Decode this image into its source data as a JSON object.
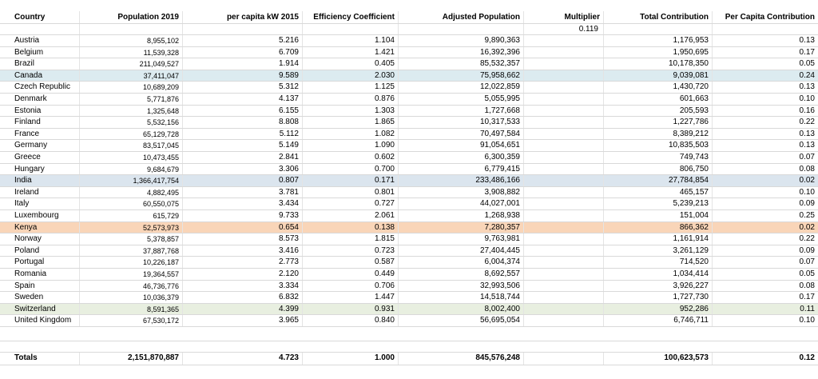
{
  "headers": {
    "country": "Country",
    "population": "Population 2019",
    "per_capita_kw": "per capita  kW 2015",
    "efficiency": "Efficiency Coefficient",
    "adjusted_population": "Adjusted Population",
    "multiplier": "Multiplier",
    "total_contribution": "Total Contribution",
    "per_capita_contribution": "Per Capita Contribution"
  },
  "multiplier_value": "0.119",
  "rows": [
    {
      "country": "Austria",
      "population": "8,955,102",
      "kw": "5.216",
      "eff": "1.104",
      "adj": "9,890,363",
      "total": "1,176,953",
      "pcc": "0.13"
    },
    {
      "country": "Belgium",
      "population": "11,539,328",
      "kw": "6.709",
      "eff": "1.421",
      "adj": "16,392,396",
      "total": "1,950,695",
      "pcc": "0.17"
    },
    {
      "country": "Brazil",
      "population": "211,049,527",
      "kw": "1.914",
      "eff": "0.405",
      "adj": "85,532,357",
      "total": "10,178,350",
      "pcc": "0.05"
    },
    {
      "country": "Canada",
      "population": "37,411,047",
      "kw": "9.589",
      "eff": "2.030",
      "adj": "75,958,662",
      "total": "9,039,081",
      "pcc": "0.24"
    },
    {
      "country": "Czech Republic",
      "population": "10,689,209",
      "kw": "5.312",
      "eff": "1.125",
      "adj": "12,022,859",
      "total": "1,430,720",
      "pcc": "0.13"
    },
    {
      "country": "Denmark",
      "population": "5,771,876",
      "kw": "4.137",
      "eff": "0.876",
      "adj": "5,055,995",
      "total": "601,663",
      "pcc": "0.10"
    },
    {
      "country": "Estonia",
      "population": "1,325,648",
      "kw": "6.155",
      "eff": "1.303",
      "adj": "1,727,668",
      "total": "205,593",
      "pcc": "0.16"
    },
    {
      "country": "Finland",
      "population": "5,532,156",
      "kw": "8.808",
      "eff": "1.865",
      "adj": "10,317,533",
      "total": "1,227,786",
      "pcc": "0.22"
    },
    {
      "country": "France",
      "population": "65,129,728",
      "kw": "5.112",
      "eff": "1.082",
      "adj": "70,497,584",
      "total": "8,389,212",
      "pcc": "0.13"
    },
    {
      "country": "Germany",
      "population": "83,517,045",
      "kw": "5.149",
      "eff": "1.090",
      "adj": "91,054,651",
      "total": "10,835,503",
      "pcc": "0.13"
    },
    {
      "country": "Greece",
      "population": "10,473,455",
      "kw": "2.841",
      "eff": "0.602",
      "adj": "6,300,359",
      "total": "749,743",
      "pcc": "0.07"
    },
    {
      "country": "Hungary",
      "population": "9,684,679",
      "kw": "3.306",
      "eff": "0.700",
      "adj": "6,779,415",
      "total": "806,750",
      "pcc": "0.08"
    },
    {
      "country": "India",
      "population": "1,366,417,754",
      "kw": "0.807",
      "eff": "0.171",
      "adj": "233,486,166",
      "total": "27,784,854",
      "pcc": "0.02"
    },
    {
      "country": "Ireland",
      "population": "4,882,495",
      "kw": "3.781",
      "eff": "0.801",
      "adj": "3,908,882",
      "total": "465,157",
      "pcc": "0.10"
    },
    {
      "country": "Italy",
      "population": "60,550,075",
      "kw": "3.434",
      "eff": "0.727",
      "adj": "44,027,001",
      "total": "5,239,213",
      "pcc": "0.09"
    },
    {
      "country": "Luxembourg",
      "population": "615,729",
      "kw": "9.733",
      "eff": "2.061",
      "adj": "1,268,938",
      "total": "151,004",
      "pcc": "0.25"
    },
    {
      "country": "Kenya",
      "population": "52,573,973",
      "kw": "0.654",
      "eff": "0.138",
      "adj": "7,280,357",
      "total": "866,362",
      "pcc": "0.02"
    },
    {
      "country": "Norway",
      "population": "5,378,857",
      "kw": "8.573",
      "eff": "1.815",
      "adj": "9,763,981",
      "total": "1,161,914",
      "pcc": "0.22"
    },
    {
      "country": "Poland",
      "population": "37,887,768",
      "kw": "3.416",
      "eff": "0.723",
      "adj": "27,404,445",
      "total": "3,261,129",
      "pcc": "0.09"
    },
    {
      "country": "Portugal",
      "population": "10,226,187",
      "kw": "2.773",
      "eff": "0.587",
      "adj": "6,004,374",
      "total": "714,520",
      "pcc": "0.07"
    },
    {
      "country": "Romania",
      "population": "19,364,557",
      "kw": "2.120",
      "eff": "0.449",
      "adj": "8,692,557",
      "total": "1,034,414",
      "pcc": "0.05"
    },
    {
      "country": "Spain",
      "population": "46,736,776",
      "kw": "3.334",
      "eff": "0.706",
      "adj": "32,993,506",
      "total": "3,926,227",
      "pcc": "0.08"
    },
    {
      "country": "Sweden",
      "population": "10,036,379",
      "kw": "6.832",
      "eff": "1.447",
      "adj": "14,518,744",
      "total": "1,727,730",
      "pcc": "0.17"
    },
    {
      "country": "Switzerland",
      "population": "8,591,365",
      "kw": "4.399",
      "eff": "0.931",
      "adj": "8,002,400",
      "total": "952,286",
      "pcc": "0.11"
    },
    {
      "country": "United Kingdom",
      "population": "67,530,172",
      "kw": "3.965",
      "eff": "0.840",
      "adj": "56,695,054",
      "total": "6,746,711",
      "pcc": "0.10"
    }
  ],
  "totals": {
    "label": "Totals",
    "population": "2,151,870,887",
    "kw": "4.723",
    "eff": "1.000",
    "adj": "845,576,248",
    "total": "100,623,573",
    "pcc": "0.12"
  },
  "highlight_colors": {
    "Canada": "#dcebf0",
    "India": "#dbe5ee",
    "Kenya": "#f9d5b8",
    "Switzerland": "#e8efe0"
  }
}
